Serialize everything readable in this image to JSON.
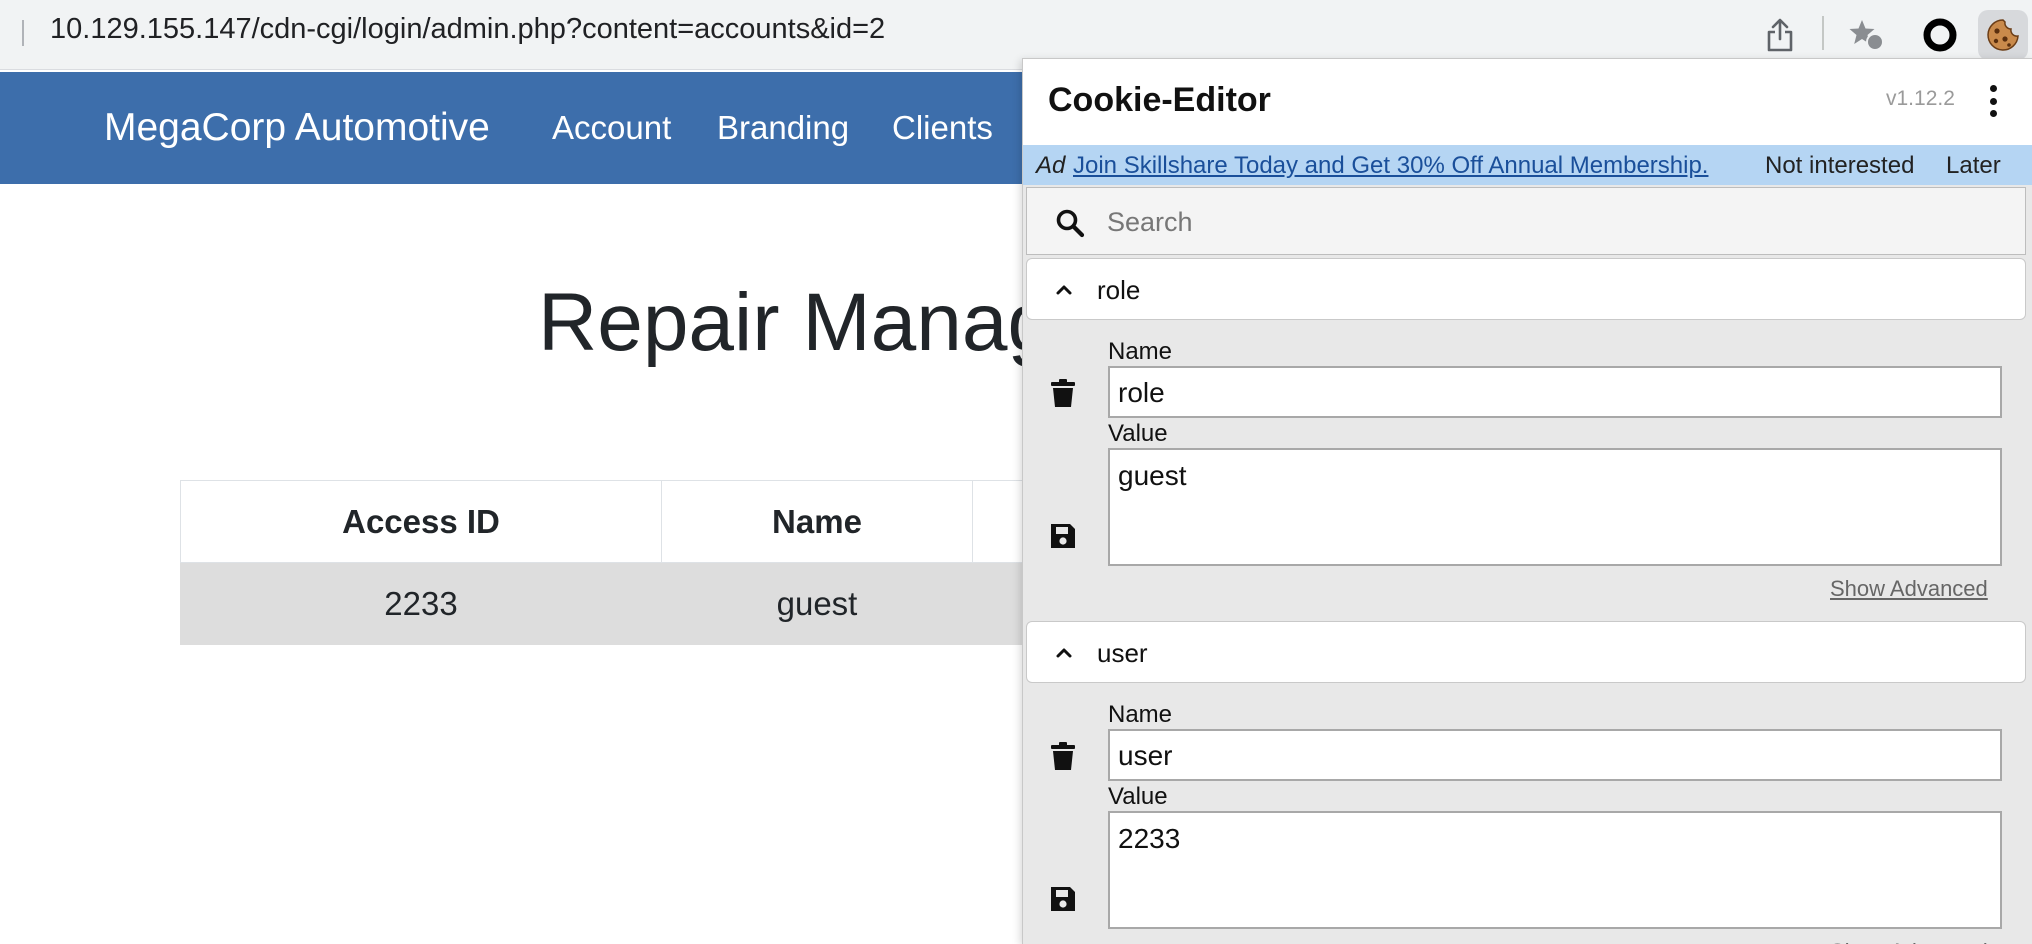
{
  "browser": {
    "url": "10.129.155.147/cdn-cgi/login/admin.php?content=accounts&id=2",
    "toolbar_icons": [
      "share-icon",
      "star-extensions-icon",
      "ring-extension-icon",
      "cookie-extension-icon"
    ]
  },
  "site": {
    "brand": "MegaCorp Automotive",
    "nav": [
      "Account",
      "Branding",
      "Clients"
    ],
    "page_title": "Repair Manag",
    "table": {
      "headers": [
        "Access ID",
        "Name"
      ],
      "rows": [
        [
          "2233",
          "guest"
        ]
      ]
    },
    "colors": {
      "navbar": "#3d6eab",
      "row_bg": "#dddddd"
    }
  },
  "cookie_editor": {
    "title": "Cookie-Editor",
    "version": "v1.12.2",
    "ad": {
      "tag": "Ad",
      "link_text": "Join Skillshare Today and Get 30% Off Annual Membership.",
      "not_interested": "Not interested",
      "later": "Later"
    },
    "search_placeholder": "Search",
    "name_label": "Name",
    "value_label": "Value",
    "show_advanced": "Show Advanced",
    "cookies": [
      {
        "header": "role",
        "name": "role",
        "value": "guest"
      },
      {
        "header": "user",
        "name": "user",
        "value": "2233"
      }
    ],
    "colors": {
      "ad_bg": "#b5d5f3",
      "panel_bg": "#e8e8e8"
    }
  }
}
